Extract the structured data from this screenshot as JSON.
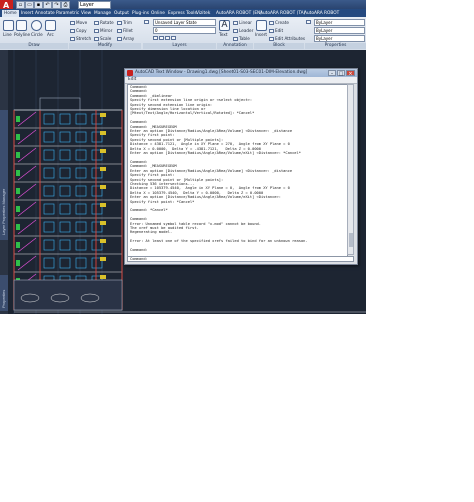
{
  "title_bar": {
    "field_value": "Layer",
    "quick_access": [
      "new-icon",
      "open-icon",
      "save-icon",
      "undo-icon",
      "redo-icon",
      "print-icon"
    ]
  },
  "tabs": [
    "Home",
    "Insert",
    "Annotate",
    "Parametric",
    "View",
    "Manage",
    "Output",
    "Plug-ins",
    "Online",
    "Express Tools",
    "Vizitek",
    "AutoARA ROBOT (EN)",
    "AutoARA ROBOT (TA)",
    "AutoARA ROBOT"
  ],
  "ribbon": {
    "draw": {
      "label": "Draw",
      "tools": [
        "Line",
        "Polyline",
        "Circle",
        "Arc"
      ]
    },
    "modify": {
      "label": "Modify",
      "tools": [
        "Move",
        "Rotate",
        "Trim",
        "Copy",
        "Mirror",
        "Fillet",
        "Stretch",
        "Scale",
        "Array"
      ]
    },
    "layers": {
      "label": "Layers",
      "combo_top": "Unsaved Layer State",
      "combo_bottom": "0"
    },
    "annotation": {
      "label": "Annotation",
      "tools": [
        "Text",
        "Linear",
        "Leader",
        "Table"
      ]
    },
    "block": {
      "label": "Block",
      "tools": [
        "Insert",
        "Create",
        "Edit",
        "Edit Attributes"
      ]
    },
    "properties": {
      "label": "Properties",
      "combo_top": "ByLayer",
      "combo_mid": "ByLayer",
      "combo_bottom": "ByLayer"
    }
  },
  "text_window": {
    "title": "AutoCAD Text Window - Drawing1.dwg [Sheet01-S03-SEC01-DIM-Elevation.dwg]",
    "menu": [
      "Edit"
    ],
    "log": [
      "Command:",
      "Command:",
      "Command: _dimlinear",
      "Specify first extension line origin or <select object>:",
      "Specify second extension line origin:",
      "Specify dimension line location or",
      "[Mtext/Text/Angle/Horizontal/Vertical/Rotated]: *Cancel*",
      "",
      "Command:",
      "Command: _MEASUREGEOM",
      "Enter an option [Distance/Radius/Angle/ARea/Volume] <Distance>: _distance",
      "Specify first point:",
      "Specify second point or [Multiple points]:",
      "Distance = 4381.7121,  Angle in XY Plane = 270,  Angle from XY Plane = 0",
      "Delta X = 0.0000,  Delta Y = -4381.7121,   Delta Z = 0.0000",
      "Enter an option [Distance/Radius/Angle/ARea/Volume/eXit] <Distance>: *Cancel*",
      "",
      "Command:",
      "Command: _MEASUREGEOM",
      "Enter an option [Distance/Radius/Angle/ARea/Volume] <Distance>: _distance",
      "Specify first point:",
      "Specify second point or [Multiple points]:",
      "Checking 536 intersections...",
      "Distance = 105379.4540,  Angle in XY Plane = 0,  Angle from XY Plane = 0",
      "Delta X = 105379.4540,  Delta Y = 0.0000,   Delta Z = 0.0000",
      "Enter an option [Distance/Radius/Angle/ARea/Volume/eXit] <Distance>:",
      "Specify first point: *Cancel*",
      "",
      "Command: *Cancel*",
      "",
      "Command:",
      "Error: Unnamed symbol table record \"x-mod\" cannot be bound.",
      "The xref must be audited first.",
      "Regenerating model.",
      "",
      "Error: At least one of the specified xrefs failed to bind for an unknown reason.",
      "",
      "Command:"
    ],
    "prompt": "Command:"
  },
  "side_labels": {
    "palette_top": "Layer Properties Manager",
    "palette_bottom": "Properties"
  },
  "colors": {
    "drawing_bg": "#1d2532",
    "title_bar": "#2a4470",
    "ribbon": "#d3dce8",
    "close_button": "#c9473b"
  }
}
